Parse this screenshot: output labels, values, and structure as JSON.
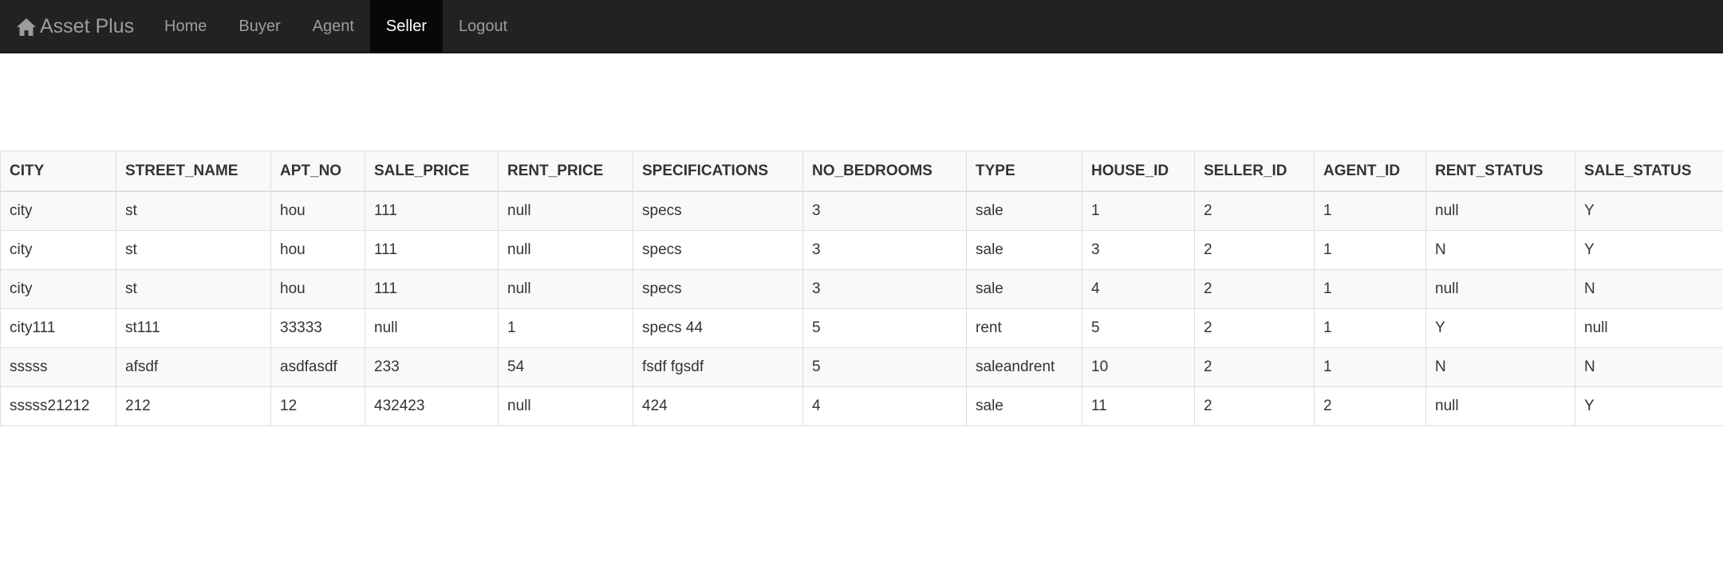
{
  "navbar": {
    "brand": "Asset Plus",
    "items": [
      {
        "label": "Home",
        "active": false
      },
      {
        "label": "Buyer",
        "active": false
      },
      {
        "label": "Agent",
        "active": false
      },
      {
        "label": "Seller",
        "active": true
      },
      {
        "label": "Logout",
        "active": false
      }
    ]
  },
  "table": {
    "columns": [
      "CITY",
      "STREET_NAME",
      "APT_NO",
      "SALE_PRICE",
      "RENT_PRICE",
      "SPECIFICATIONS",
      "NO_BEDROOMS",
      "TYPE",
      "HOUSE_ID",
      "SELLER_ID",
      "AGENT_ID",
      "RENT_STATUS",
      "SALE_STATUS"
    ],
    "rows": [
      [
        "city",
        "st",
        "hou",
        "111",
        "null",
        "specs",
        "3",
        "sale",
        "1",
        "2",
        "1",
        "null",
        "Y"
      ],
      [
        "city",
        "st",
        "hou",
        "111",
        "null",
        "specs",
        "3",
        "sale",
        "3",
        "2",
        "1",
        "N",
        "Y"
      ],
      [
        "city",
        "st",
        "hou",
        "111",
        "null",
        "specs",
        "3",
        "sale",
        "4",
        "2",
        "1",
        "null",
        "N"
      ],
      [
        "city111",
        "st111",
        "33333",
        "null",
        "1",
        "specs 44",
        "5",
        "rent",
        "5",
        "2",
        "1",
        "Y",
        "null"
      ],
      [
        "sssss",
        "afsdf",
        "asdfasdf",
        "233",
        "54",
        "fsdf fgsdf",
        "5",
        "saleandrent",
        "10",
        "2",
        "1",
        "N",
        "N"
      ],
      [
        "sssss21212",
        "212",
        "12",
        "432423",
        "null",
        "424",
        "4",
        "sale",
        "11",
        "2",
        "2",
        "null",
        "Y"
      ]
    ]
  }
}
